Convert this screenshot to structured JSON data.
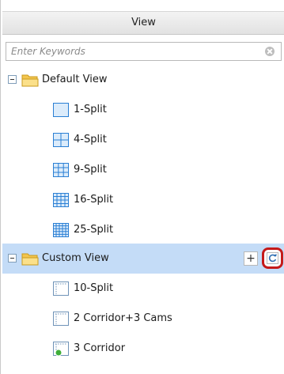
{
  "header": {
    "title": "View"
  },
  "search": {
    "placeholder": "Enter Keywords",
    "value": ""
  },
  "tree": {
    "default_view": {
      "label": "Default View",
      "items": [
        {
          "label": "1-Split",
          "icon": "split-1-icon"
        },
        {
          "label": "4-Split",
          "icon": "split-4-icon"
        },
        {
          "label": "9-Split",
          "icon": "split-9-icon"
        },
        {
          "label": "16-Split",
          "icon": "split-16-icon"
        },
        {
          "label": "25-Split",
          "icon": "split-25-icon"
        }
      ]
    },
    "custom_view": {
      "label": "Custom View",
      "add_label": "+",
      "items": [
        {
          "label": "10-Split",
          "icon": "split-custom-icon"
        },
        {
          "label": "2 Corridor+3 Cams",
          "icon": "split-custom-icon"
        },
        {
          "label": "3 Corridor",
          "icon": "split-custom-default-icon"
        }
      ]
    }
  },
  "colors": {
    "selected_row": "#c4dcf7",
    "grid_blue": "#2a7fd4",
    "highlight_ring": "#c41a1a",
    "folder_yellow": "#f3c54e"
  }
}
